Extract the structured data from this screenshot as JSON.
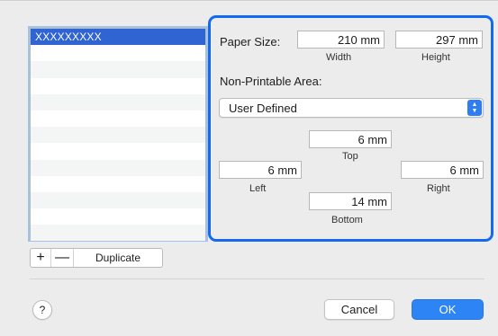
{
  "list": {
    "selected_item": "XXXXXXXXX",
    "row_count": 13
  },
  "list_buttons": {
    "add": "+",
    "remove": "—",
    "duplicate": "Duplicate"
  },
  "paper_size": {
    "label": "Paper Size:",
    "width": "210 mm",
    "width_label": "Width",
    "height": "297 mm",
    "height_label": "Height"
  },
  "non_printable": {
    "label": "Non-Printable Area:",
    "selected": "User Defined",
    "top": "6 mm",
    "top_label": "Top",
    "left": "6 mm",
    "left_label": "Left",
    "right": "6 mm",
    "right_label": "Right",
    "bottom": "14 mm",
    "bottom_label": "Bottom"
  },
  "footer": {
    "help": "?",
    "cancel": "Cancel",
    "ok": "OK"
  },
  "colors": {
    "highlight": "#1469f0",
    "selection": "#2f64d2",
    "ok_button": "#2d84f5"
  }
}
